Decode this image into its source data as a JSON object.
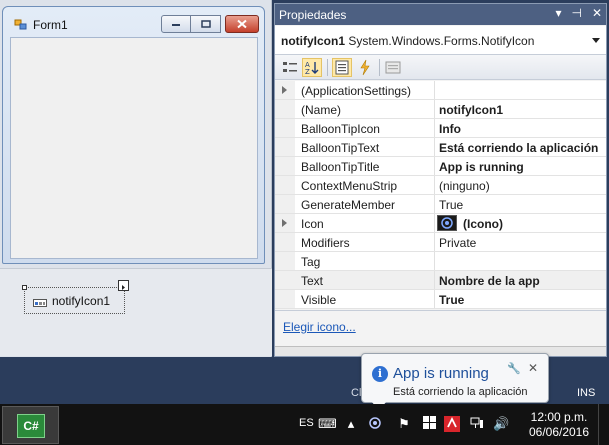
{
  "form": {
    "title": "Form1",
    "component_label": "notifyIcon1"
  },
  "properties": {
    "panel_title": "Propiedades",
    "pin_glyph": "▾ ⊣ ✕",
    "object_name": "notifyIcon1",
    "object_type": "System.Windows.Forms.NotifyIcon",
    "rows": [
      {
        "name": "(ApplicationSettings)",
        "value": "",
        "expandable": true,
        "bold": false
      },
      {
        "name": "(Name)",
        "value": "notifyIcon1",
        "bold": true
      },
      {
        "name": "BalloonTipIcon",
        "value": "Info",
        "bold": true
      },
      {
        "name": "BalloonTipText",
        "value": "Está corriendo la aplicación",
        "bold": true
      },
      {
        "name": "BalloonTipTitle",
        "value": "App is running",
        "bold": true
      },
      {
        "name": "ContextMenuStrip",
        "value": "(ninguno)",
        "bold": false
      },
      {
        "name": "GenerateMember",
        "value": "True",
        "bold": false
      },
      {
        "name": "Icon",
        "value": "(Icono)",
        "bold": true,
        "expandable": true,
        "has_icon": true
      },
      {
        "name": "Modifiers",
        "value": "Private",
        "bold": false
      },
      {
        "name": "Tag",
        "value": "",
        "bold": false
      },
      {
        "name": "Text",
        "value": "Nombre de la app",
        "bold": true,
        "selected": true
      },
      {
        "name": "Visible",
        "value": "True",
        "bold": true
      }
    ],
    "command_link": "Elegir icono..."
  },
  "status": {
    "ch_text": "Cl",
    "ins_text": "INS"
  },
  "balloon": {
    "title": "App is running",
    "text": "Está corriendo la aplicación"
  },
  "taskbar": {
    "app_label": "C#",
    "lang": "ES",
    "time": "12:00 p.m.",
    "date": "06/06/2016"
  },
  "colors": {
    "panel_header": "#4d6082",
    "link": "#1b58b8",
    "balloon_title": "#1e4f9a",
    "taskbar": "#121212"
  }
}
